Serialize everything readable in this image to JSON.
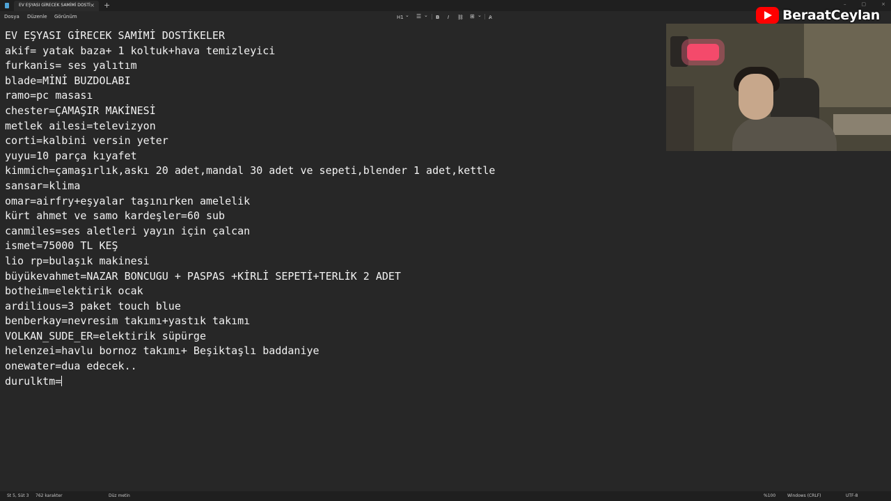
{
  "tab": {
    "title": "EV EŞYASI GİRECEK SAMİMİ DOSTİ",
    "close": "×",
    "new": "+"
  },
  "window_controls": [
    "–",
    "▢",
    "×"
  ],
  "menu": [
    "Dosya",
    "Düzenle",
    "Görünüm"
  ],
  "toolbar": {
    "heading": "H1",
    "heading_chevron": "⌄",
    "list": "☰",
    "list_chevron": "⌄",
    "bold": "B",
    "italic": "I",
    "link": "⛓",
    "table": "⊞",
    "table_chevron": "⌄",
    "clear_format": "A̷"
  },
  "editor": {
    "lines": [
      "EV EŞYASI GİRECEK SAMİMİ DOSTİKELER",
      "akif= yatak baza+ 1 koltuk+hava temizleyici",
      "furkanis= ses yalıtım",
      "blade=MİNİ BUZDOLABI",
      "ramo=pc masası",
      "chester=ÇAMAŞIR MAKİNESİ",
      "metlek ailesi=televizyon",
      "corti=kalbini versin yeter",
      "yuyu=10 parça kıyafet",
      "kimmich=çamaşırlık,askı 20 adet,mandal 30 adet ve sepeti,blender 1 adet,kettle",
      "sansar=klima",
      "omar=airfry+eşyalar taşınırken amelelik",
      "kürt ahmet ve samo kardeşler=60 sub",
      "canmiles=ses aletleri yayın için çalcan",
      "ismet=75000 TL KEŞ",
      "lio rp=bulaşık makinesi",
      "büyükevahmet=NAZAR BONCUGU + PASPAS +KİRLİ SEPETİ+TERLİK 2 ADET",
      "botheim=elektirik ocak",
      "ardilious=3 paket touch blue",
      "benberkay=nevresim takımı+yastık takımı",
      "VOLKAN_SUDE_ER=elektirik süpürge",
      "helenzei=havlu bornoz takımı+ Beşiktaşlı baddaniye",
      "onewater=dua edecek..",
      "durulktm="
    ]
  },
  "overlay": {
    "channel_name": "BeraatCeylan",
    "brand_color": "#ff0000"
  },
  "status": {
    "position": "St 5, Süt 3",
    "char_count": "762 karakter",
    "format": "Düz metin",
    "zoom": "%100",
    "line_ending": "Windows (CRLF)",
    "encoding": "UTF-8"
  }
}
